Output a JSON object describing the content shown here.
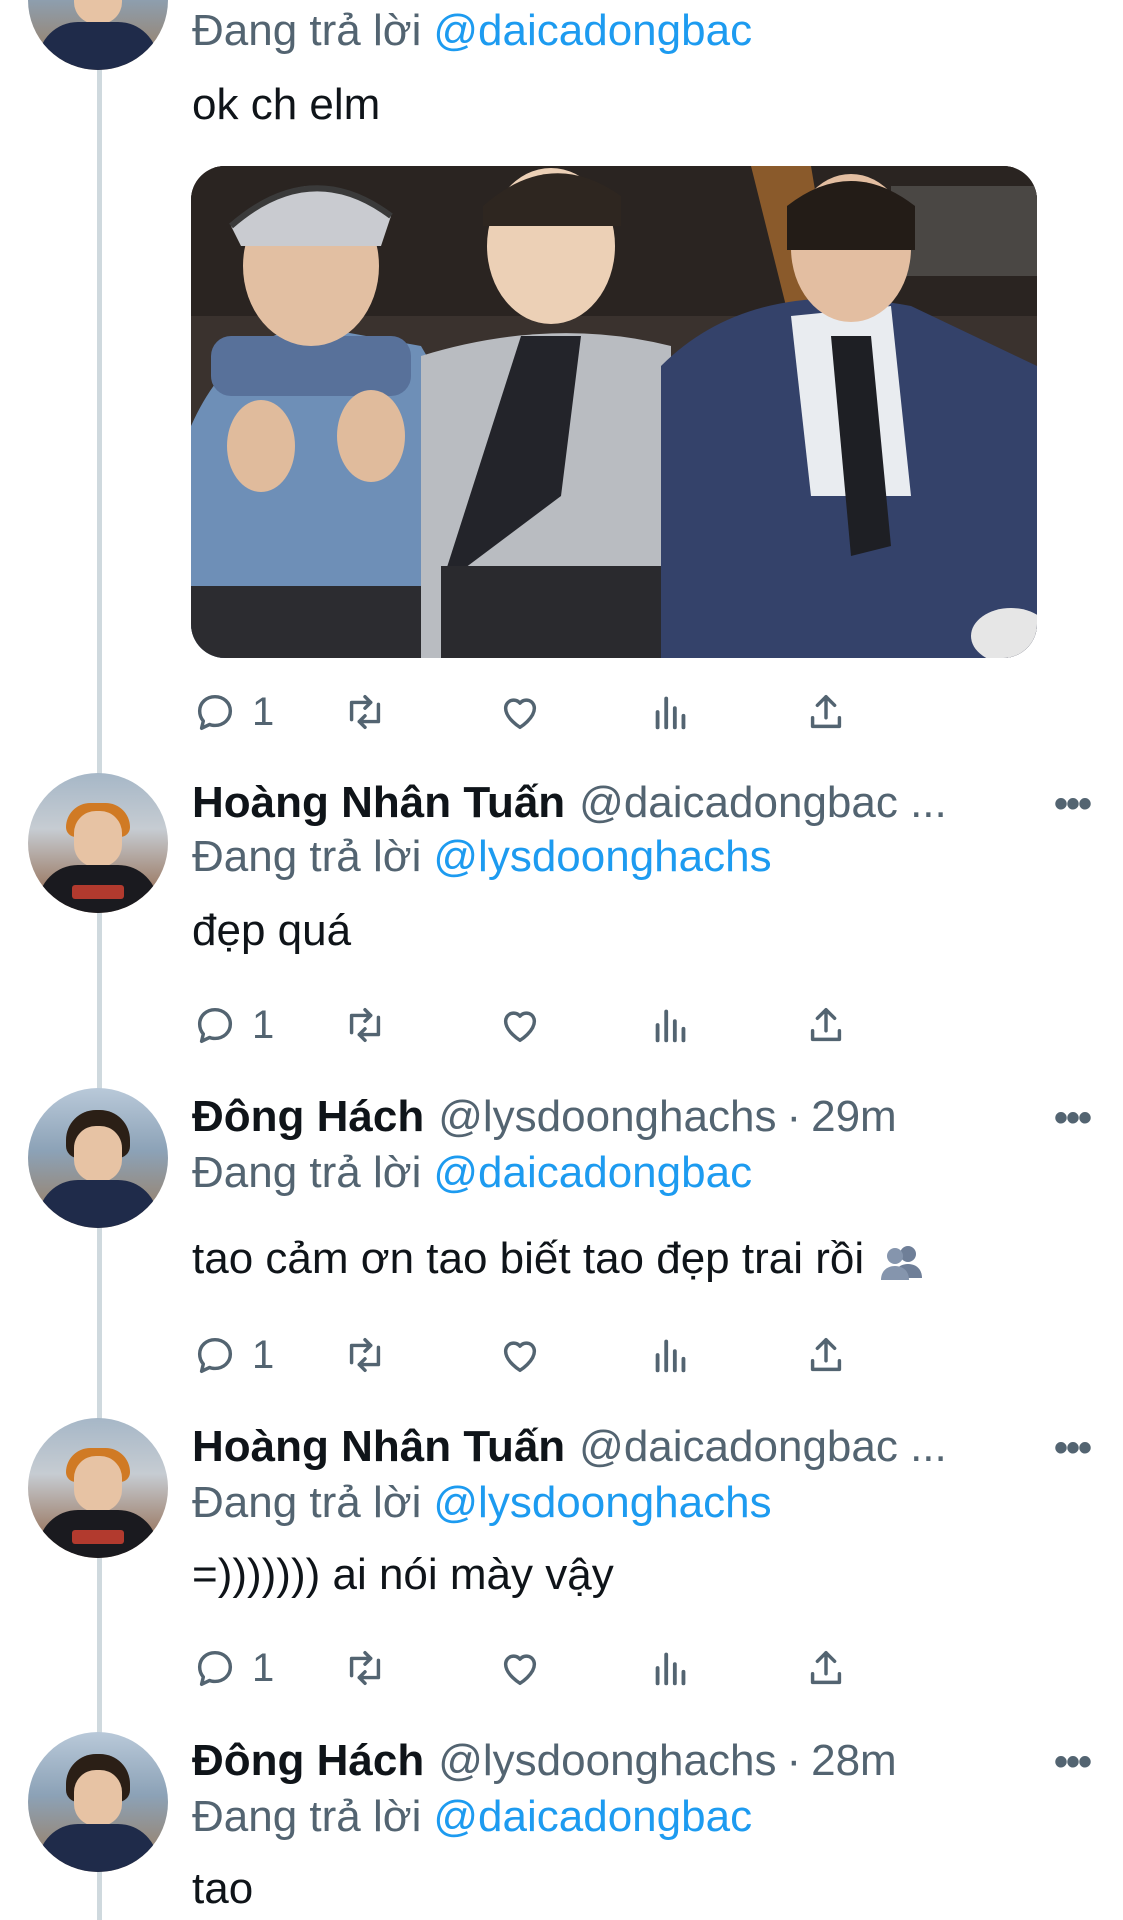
{
  "ui": {
    "reply_prefix": "Đang trả lời",
    "separator": "·",
    "more_label": "•••"
  },
  "tweets": [
    {
      "reply_to": "@daicadongbac",
      "text": "ok ch elm",
      "has_media": true,
      "media": {
        "description_icon": "photo-of-three-young-men"
      },
      "reply_count": "1"
    },
    {
      "name": "Hoàng Nhân Tuấn",
      "handle": "@daicadongbac ...",
      "reply_to": "@lysdoonghachs",
      "text": "đẹp quá",
      "reply_count": "1"
    },
    {
      "name": "Đông Hách",
      "handle": "@lysdoonghachs",
      "time": "29m",
      "reply_to": "@daicadongbac",
      "text": "tao cảm ơn tao biết tao đẹp trai rồi",
      "emoji": "busts-in-silhouette-emoji",
      "reply_count": "1"
    },
    {
      "name": "Hoàng Nhân Tuấn",
      "handle": "@daicadongbac ...",
      "reply_to": "@lysdoonghachs",
      "text": "=))))))) ai nói mày vậy",
      "reply_count": "1"
    },
    {
      "name": "Đông Hách",
      "handle": "@lysdoonghachs",
      "time": "28m",
      "reply_to": "@daicadongbac",
      "text": "tao"
    }
  ],
  "colors": {
    "link": "#1d9bf0",
    "secondary": "#536471",
    "thread_line": "#cfd9de"
  },
  "icons": [
    "reply-icon",
    "retweet-icon",
    "like-icon",
    "views-icon",
    "share-icon",
    "more-icon"
  ]
}
